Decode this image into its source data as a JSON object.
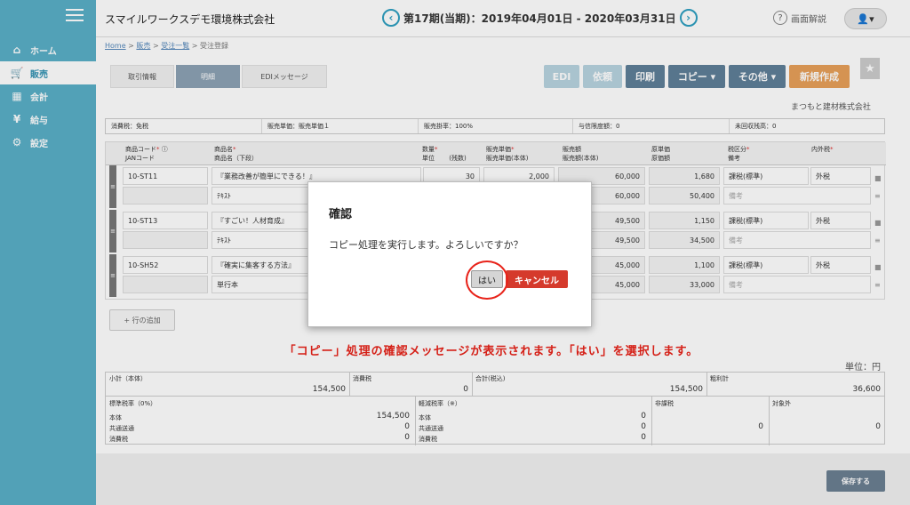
{
  "sidebar": {
    "items": [
      {
        "label": "ホーム",
        "icon": "home-icon",
        "glyph": "⌂"
      },
      {
        "label": "販売",
        "icon": "cart-icon",
        "glyph": "🛒"
      },
      {
        "label": "会計",
        "icon": "calculator-icon",
        "glyph": "▦"
      },
      {
        "label": "給与",
        "icon": "money-bag-icon",
        "glyph": "¥"
      },
      {
        "label": "設定",
        "icon": "gear-icon",
        "glyph": "⚙"
      }
    ]
  },
  "header": {
    "company": "スマイルワークスデモ環境株式会社",
    "period": "第17期(当期)：2019年04月01日 - 2020年03月31日",
    "prev": "‹",
    "next": "›",
    "help_label": "画面解説",
    "help_q": "?",
    "user_glyph": "👤▾"
  },
  "breadcrumb": {
    "home": "Home",
    "sales": "販売",
    "orders": "受注一覧",
    "current": "受注登録",
    "sep": ">"
  },
  "tabs": [
    "取引情報",
    "明細",
    "EDIメッセージ"
  ],
  "toolbar": {
    "edi": "EDI",
    "request": "依頼",
    "print": "印刷",
    "copy": "コピー ▾",
    "other": "その他 ▾",
    "new": "新規作成",
    "star": "★"
  },
  "partner": "まつもと建材株式会社",
  "info": [
    "消費税：免税",
    "販売単価：販売単価１",
    "販売掛率：100%",
    "与信限度額：0",
    "未回収残高：0"
  ],
  "line_headers": {
    "code": "商品コード",
    "jan": "JANコード",
    "name": "商品名",
    "name2": "商品名（下段）",
    "qty": "数量",
    "unit": "単位",
    "qty_unit": "(残数)",
    "price": "販売単価",
    "price_net": "販売単価(本体)",
    "amount": "販売額",
    "amount_net": "販売額(本体)",
    "cost": "原単価",
    "cost_amt": "原価額",
    "tax_class": "税区分",
    "note": "備考",
    "tax_in": "内外税",
    "req": "*",
    "info_glyph": "ⓘ"
  },
  "lines": [
    {
      "code": "10-ST11",
      "name": "『業務改善が簡単にできる！』",
      "sub": "ﾃｷｽﾄ",
      "qty": "30",
      "price": "2,000",
      "amount": "60,000",
      "amount_net": "60,000",
      "cost": "1,680",
      "cost_amt": "50,400",
      "tax": "課税(標準)",
      "inout": "外税",
      "note": "備考"
    },
    {
      "code": "10-ST13",
      "name": "『すごい！人材育成』",
      "sub": "ﾃｷｽﾄ",
      "qty": "",
      "price": "",
      "amount": "49,500",
      "amount_net": "49,500",
      "cost": "1,150",
      "cost_amt": "34,500",
      "tax": "課税(標準)",
      "inout": "外税",
      "note": "備考"
    },
    {
      "code": "10-SH52",
      "name": "『確実に集客する方法』",
      "sub": "単行本",
      "qty": "",
      "price": "",
      "amount": "45,000",
      "amount_net": "45,000",
      "cost": "1,100",
      "cost_amt": "33,000",
      "tax": "課税(標準)",
      "inout": "外税",
      "note": "備考"
    }
  ],
  "add_row": "+ 行の追加",
  "instruction": "「コピー」処理の確認メッセージが表示されます。「はい」を選択します。",
  "unit": "単位：円",
  "totals": {
    "subtotal_label": "小計（本体）",
    "subtotal": "154,500",
    "tax_label": "消費税",
    "tax": "0",
    "total_label": "合計(税込)",
    "total": "154,500",
    "gross_label": "粗利計",
    "gross": "36,600",
    "std_label": "標準税率（0%）",
    "std_body": "本体",
    "std_body_v": "154,500",
    "std_mid": "共通送通",
    "std_mid_v": "0",
    "std_tax": "消費税",
    "std_tax_v": "0",
    "red_label": "軽減税率（※）",
    "red_body": "本体",
    "red_body_v": "0",
    "red_mid": "共通送通",
    "red_mid_v": "0",
    "red_tax": "消費税",
    "red_tax_v": "0",
    "nontax_label": "非課税",
    "nontax_v": "0",
    "exempt_label": "対象外",
    "exempt_v": "0"
  },
  "save": "保存する",
  "modal": {
    "title": "確認",
    "message": "コピー処理を実行します。よろしいですか？",
    "yes": "はい",
    "cancel": "キャンセル"
  }
}
